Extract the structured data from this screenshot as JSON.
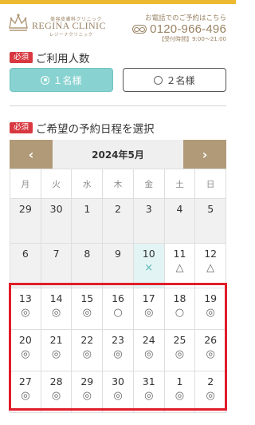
{
  "header": {
    "brand_sub": "美容皮膚科クリニック",
    "brand_name": "REGINA CLINIC",
    "brand_kana": "レジーナクリニック",
    "phone_caption": "お電話でのご予約はこちら",
    "phone_number": "0120-966-496",
    "phone_hours": "【受付時間】9:00〜21:00"
  },
  "people_section": {
    "required_badge": "必須",
    "title": "ご利用人数",
    "options": [
      {
        "label": "１名様",
        "selected": true
      },
      {
        "label": "２名様",
        "selected": false
      }
    ]
  },
  "schedule_section": {
    "required_badge": "必須",
    "title": "ご希望の予約日程を選択"
  },
  "calendar": {
    "prev_icon": "‹",
    "next_icon": "›",
    "month_label": "2024年5月",
    "weekdays": [
      "月",
      "火",
      "水",
      "木",
      "金",
      "土",
      "日"
    ],
    "weeks": [
      [
        {
          "day": "29",
          "mark": ""
        },
        {
          "day": "30",
          "mark": ""
        },
        {
          "day": "1",
          "mark": ""
        },
        {
          "day": "2",
          "mark": ""
        },
        {
          "day": "3",
          "mark": ""
        },
        {
          "day": "4",
          "mark": ""
        },
        {
          "day": "5",
          "mark": ""
        }
      ],
      [
        {
          "day": "6",
          "mark": ""
        },
        {
          "day": "7",
          "mark": ""
        },
        {
          "day": "8",
          "mark": ""
        },
        {
          "day": "9",
          "mark": ""
        },
        {
          "day": "10",
          "mark": "×"
        },
        {
          "day": "11",
          "mark": "△"
        },
        {
          "day": "12",
          "mark": "△"
        }
      ],
      [
        {
          "day": "13",
          "mark": "◎"
        },
        {
          "day": "14",
          "mark": "◎"
        },
        {
          "day": "15",
          "mark": "◎"
        },
        {
          "day": "16",
          "mark": "○"
        },
        {
          "day": "17",
          "mark": "◎"
        },
        {
          "day": "18",
          "mark": "○"
        },
        {
          "day": "19",
          "mark": "◎"
        }
      ],
      [
        {
          "day": "20",
          "mark": "◎"
        },
        {
          "day": "21",
          "mark": "◎"
        },
        {
          "day": "22",
          "mark": "◎"
        },
        {
          "day": "23",
          "mark": "◎"
        },
        {
          "day": "24",
          "mark": "◎"
        },
        {
          "day": "25",
          "mark": "◎"
        },
        {
          "day": "26",
          "mark": "◎"
        }
      ],
      [
        {
          "day": "27",
          "mark": "◎"
        },
        {
          "day": "28",
          "mark": "◎"
        },
        {
          "day": "29",
          "mark": "◎"
        },
        {
          "day": "30",
          "mark": "◎"
        },
        {
          "day": "31",
          "mark": "◎"
        },
        {
          "day": "1",
          "mark": "◎"
        },
        {
          "day": "2",
          "mark": "◎"
        }
      ]
    ]
  },
  "colors": {
    "accent_gold": "#ecb930",
    "brand_brown": "#9a8364",
    "selected_teal": "#88d3d1",
    "required_red": "#d8383f",
    "highlight_red": "#e11d2a"
  }
}
